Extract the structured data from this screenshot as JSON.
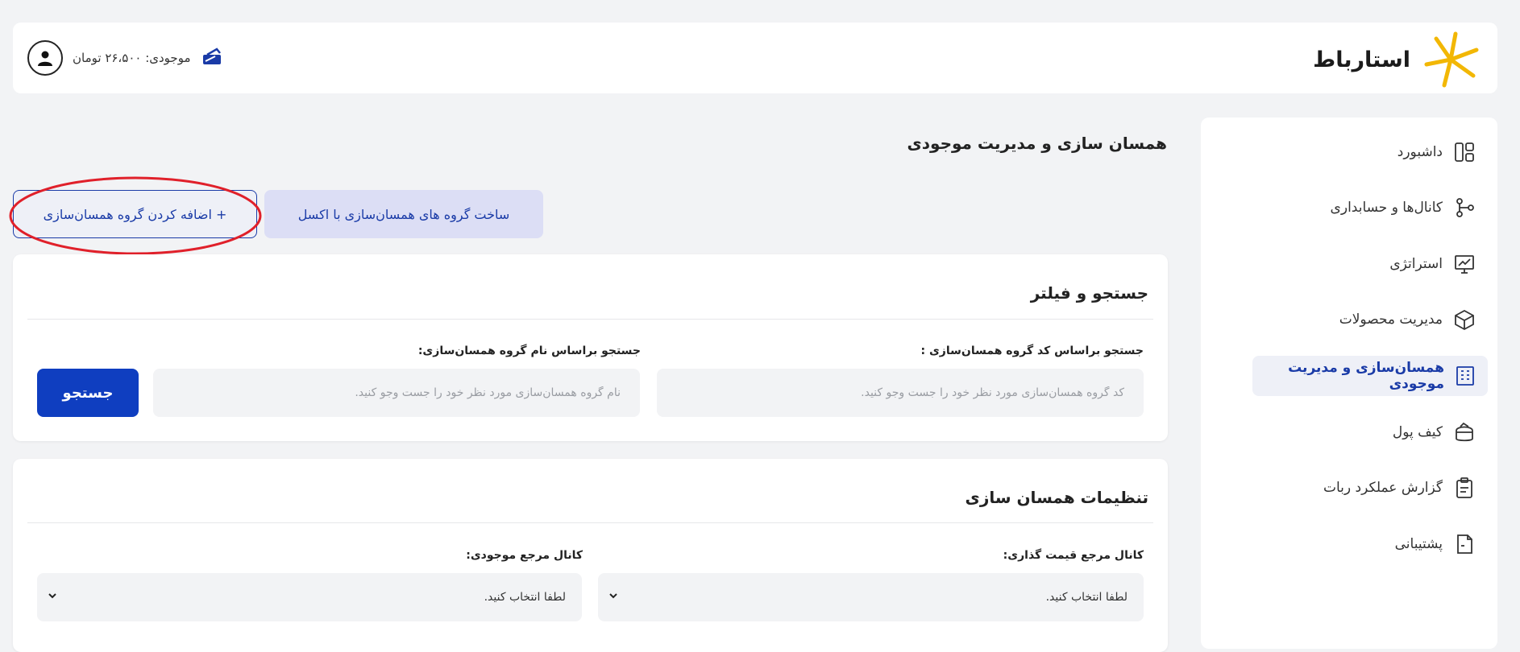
{
  "brand": {
    "name": "استارباط"
  },
  "header": {
    "balance_text": "موجودی: ۲۶،۵۰۰ تومان",
    "wallet_icon": "wallet-icon",
    "avatar_icon": "user-icon"
  },
  "sidebar": {
    "items": [
      {
        "label": "داشبورد",
        "icon": "dashboard-icon"
      },
      {
        "label": "کانال‌ها و حسابداری",
        "icon": "channels-icon"
      },
      {
        "label": "استراتژی",
        "icon": "strategy-icon"
      },
      {
        "label": "مدیریت محصولات",
        "icon": "box-icon"
      },
      {
        "label": "همسان‌سازی و مدیریت موجودی",
        "icon": "building-icon",
        "active": true
      },
      {
        "label": "کیف پول",
        "icon": "wallet-icon"
      },
      {
        "label": "گزارش عملکرد ربات",
        "icon": "clipboard-icon"
      },
      {
        "label": "پشتیبانی",
        "icon": "support-icon"
      }
    ]
  },
  "main": {
    "title": "همسان سازی و مدیریت موجودی",
    "excel_button": "ساخت گروه های همسان‌سازی با اکسل",
    "add_button": "+ اضافه کردن گروه همسان‌سازی",
    "search": {
      "title": "جستجو و فیلتر",
      "code_label": "جستجو براساس کد گروه همسان‌سازی :",
      "code_placeholder": "کد گروه همسان‌سازی مورد نظر خود را جست وجو کنید.",
      "name_label": "جستجو براساس نام گروه همسان‌سازی:",
      "name_placeholder": "نام گروه همسان‌سازی مورد نظر خود را جست وجو کنید.",
      "button": "جستجو"
    },
    "settings": {
      "title": "تنظیمات همسان سازی",
      "pricing_label": "کانال مرجع قیمت گذاری:",
      "pricing_value": "لطفا انتخاب کنید.",
      "stock_label": "کانال مرجع موجودی:",
      "stock_value": "لطفا انتخاب کنید."
    }
  },
  "colors": {
    "accent": "#0f3ec0",
    "annotation": "#e0202a",
    "logo": "#f2b705"
  }
}
